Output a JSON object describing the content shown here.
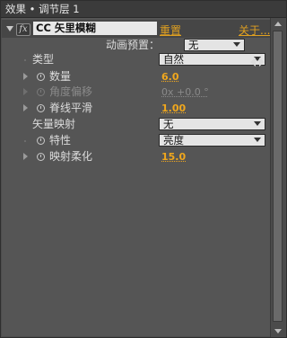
{
  "panel": {
    "title": "效果 • 调节层 1"
  },
  "effect": {
    "name": "CC 矢里模糊",
    "reset_label": "重置",
    "about_label": "关于..."
  },
  "animation_preset": {
    "label": "动画预置：",
    "value": "无"
  },
  "properties": [
    {
      "label": "类型",
      "kind": "dropdown",
      "value": "自然",
      "enabled": true
    },
    {
      "label": "数量",
      "kind": "number",
      "value": "6.0",
      "enabled": true
    },
    {
      "label": "角度偏移",
      "kind": "number",
      "value": "0x +0.0 °",
      "enabled": false
    },
    {
      "label": "脊线平滑",
      "kind": "number",
      "value": "1.00",
      "enabled": true
    },
    {
      "label": "矢量映射",
      "kind": "dropdown",
      "value": "无",
      "enabled": true
    },
    {
      "label": "特性",
      "kind": "dropdown",
      "value": "亮度",
      "enabled": true
    },
    {
      "label": "映射柔化",
      "kind": "number",
      "value": "15.0",
      "enabled": true
    }
  ],
  "colors": {
    "accent": "#f0a71d",
    "panel_bg": "#555555",
    "title_bg": "#3b3b3b"
  }
}
